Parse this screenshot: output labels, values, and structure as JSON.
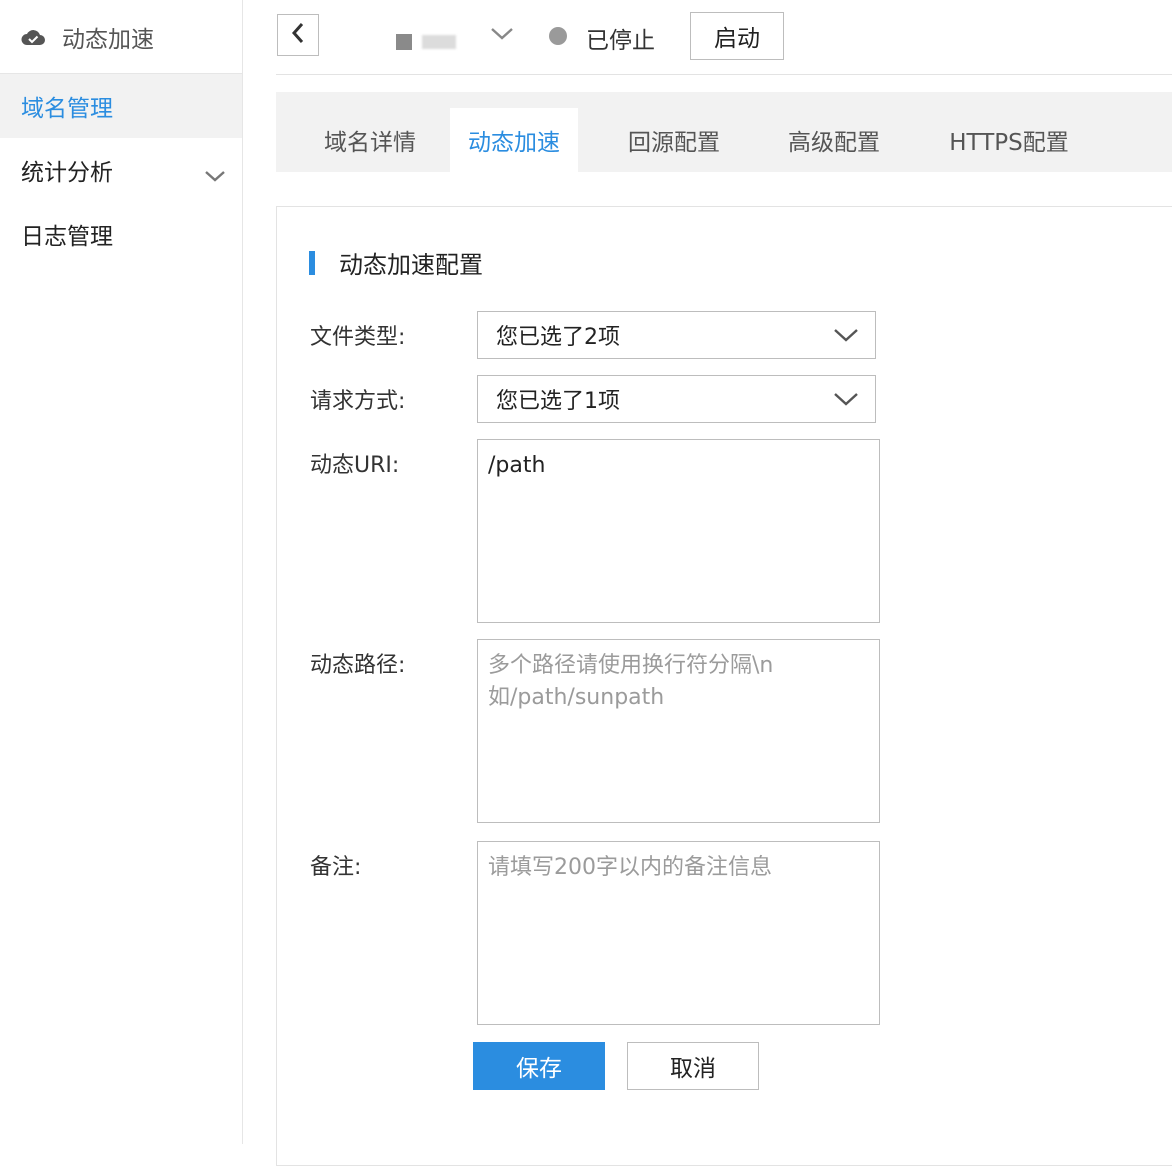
{
  "sidebar": {
    "header_title": "动态加速",
    "items": [
      {
        "label": "域名管理",
        "active": true
      },
      {
        "label": "统计分析",
        "has_submenu": true
      },
      {
        "label": "日志管理"
      }
    ]
  },
  "topbar": {
    "status_text": "已停止",
    "start_label": "启动"
  },
  "tabs": [
    "域名详情",
    "动态加速",
    "回源配置",
    "高级配置",
    "HTTPS配置"
  ],
  "active_tab_index": 1,
  "section": {
    "title": "动态加速配置"
  },
  "form": {
    "file_type_label": "文件类型:",
    "file_type_value": "您已选了2项",
    "request_method_label": "请求方式:",
    "request_method_value": "您已选了1项",
    "dynamic_uri_label": "动态URI:",
    "dynamic_uri_value": "/path",
    "dynamic_path_label": "动态路径:",
    "dynamic_path_placeholder": "多个路径请使用换行符分隔\\n如/path/sunpath",
    "remark_label": "备注:",
    "remark_placeholder": "请填写200字以内的备注信息"
  },
  "actions": {
    "save_label": "保存",
    "cancel_label": "取消"
  },
  "colors": {
    "accent": "#2b8de0",
    "status_stopped": "#9a9a9a"
  }
}
